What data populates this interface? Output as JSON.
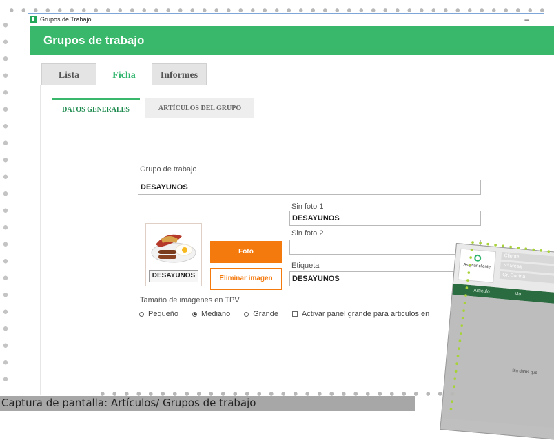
{
  "window": {
    "title": "Grupos de Trabajo",
    "minimize": "–"
  },
  "header": {
    "title": "Grupos de trabajo"
  },
  "tabs": [
    {
      "label": "Lista"
    },
    {
      "label": "Ficha",
      "active": true
    },
    {
      "label": "Informes"
    }
  ],
  "subtabs": [
    {
      "label": "DATOS GENERALES",
      "active": true
    },
    {
      "label": "ARTÍCULOS DEL GRUPO"
    }
  ],
  "form": {
    "grupo_label": "Grupo de trabajo",
    "grupo_value": "DESAYUNOS",
    "sin_foto1_label": "Sin foto 1",
    "sin_foto1_value": "DESAYUNOS",
    "sin_foto2_label": "Sin foto 2",
    "sin_foto2_value": "",
    "etiqueta_label": "Etiqueta",
    "etiqueta_value": "DESAYUNOS",
    "photo_caption": "DESAYUNOS",
    "btn_foto": "Foto",
    "btn_eliminar": "Eliminar imagen",
    "tamano_label": "Tamaño de imágenes en TPV",
    "options": [
      "Pequeño",
      "Mediano",
      "Grande"
    ],
    "selected_option": "Mediano",
    "panel_checkbox": "Activar panel grande para articulos en"
  },
  "overlay": {
    "assign": "Asignar cliente",
    "tabs": [
      "Cliente",
      "Nº Mesa",
      "Gr. Cocina"
    ],
    "columns": [
      "Artículo",
      "Mo"
    ],
    "nodata": "Sin datos que"
  },
  "caption": "Captura de pantalla: Artículos/ Grupos de trabajo",
  "colors": {
    "green": "#39b86b",
    "orange": "#f47a0e",
    "dark_green": "#2a6b3f"
  }
}
